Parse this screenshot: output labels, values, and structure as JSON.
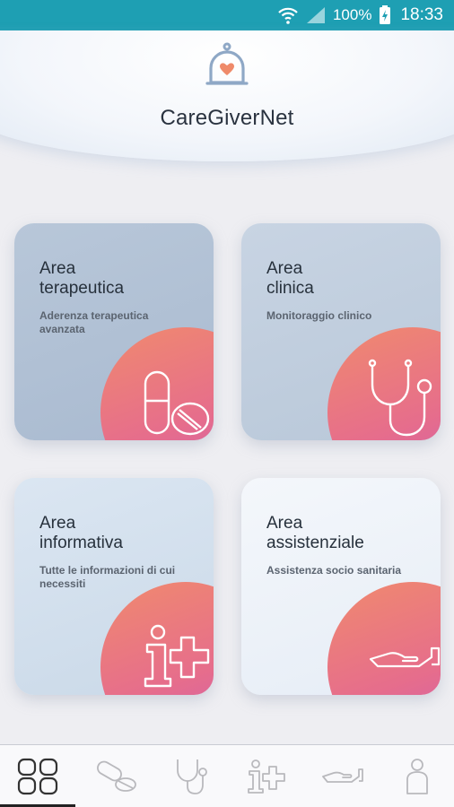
{
  "status_bar": {
    "battery": "100%",
    "time": "18:33",
    "icons": [
      "wifi-icon",
      "signal-icon",
      "battery-charging-icon"
    ]
  },
  "header": {
    "logo_icon": "bell-heart-icon",
    "title": "CareGiverNet"
  },
  "cards": [
    {
      "title_line1": "Area",
      "title_line2": "terapeutica",
      "subtitle": "Aderenza terapeutica avanzata",
      "icon": "pills-icon"
    },
    {
      "title_line1": "Area",
      "title_line2": "clinica",
      "subtitle": "Monitoraggio clinico",
      "icon": "stethoscope-icon"
    },
    {
      "title_line1": "Area",
      "title_line2": "informativa",
      "subtitle": "Tutte le informazioni di cui necessiti",
      "icon": "info-cross-icon"
    },
    {
      "title_line1": "Area",
      "title_line2": "assistenziale",
      "subtitle": "Assistenza socio sanitaria",
      "icon": "open-hand-icon"
    }
  ],
  "bottom_nav": {
    "items": [
      "home-grid-icon",
      "pills-icon",
      "stethoscope-icon",
      "info-cross-icon",
      "open-hand-icon",
      "profile-icon"
    ],
    "active": "home-grid-icon"
  },
  "colors": {
    "status_bar": "#1e9fb3",
    "accent_gradient_start": "#f08a6e",
    "accent_gradient_end": "#c85ab7",
    "heart": "#ef8a6a"
  }
}
